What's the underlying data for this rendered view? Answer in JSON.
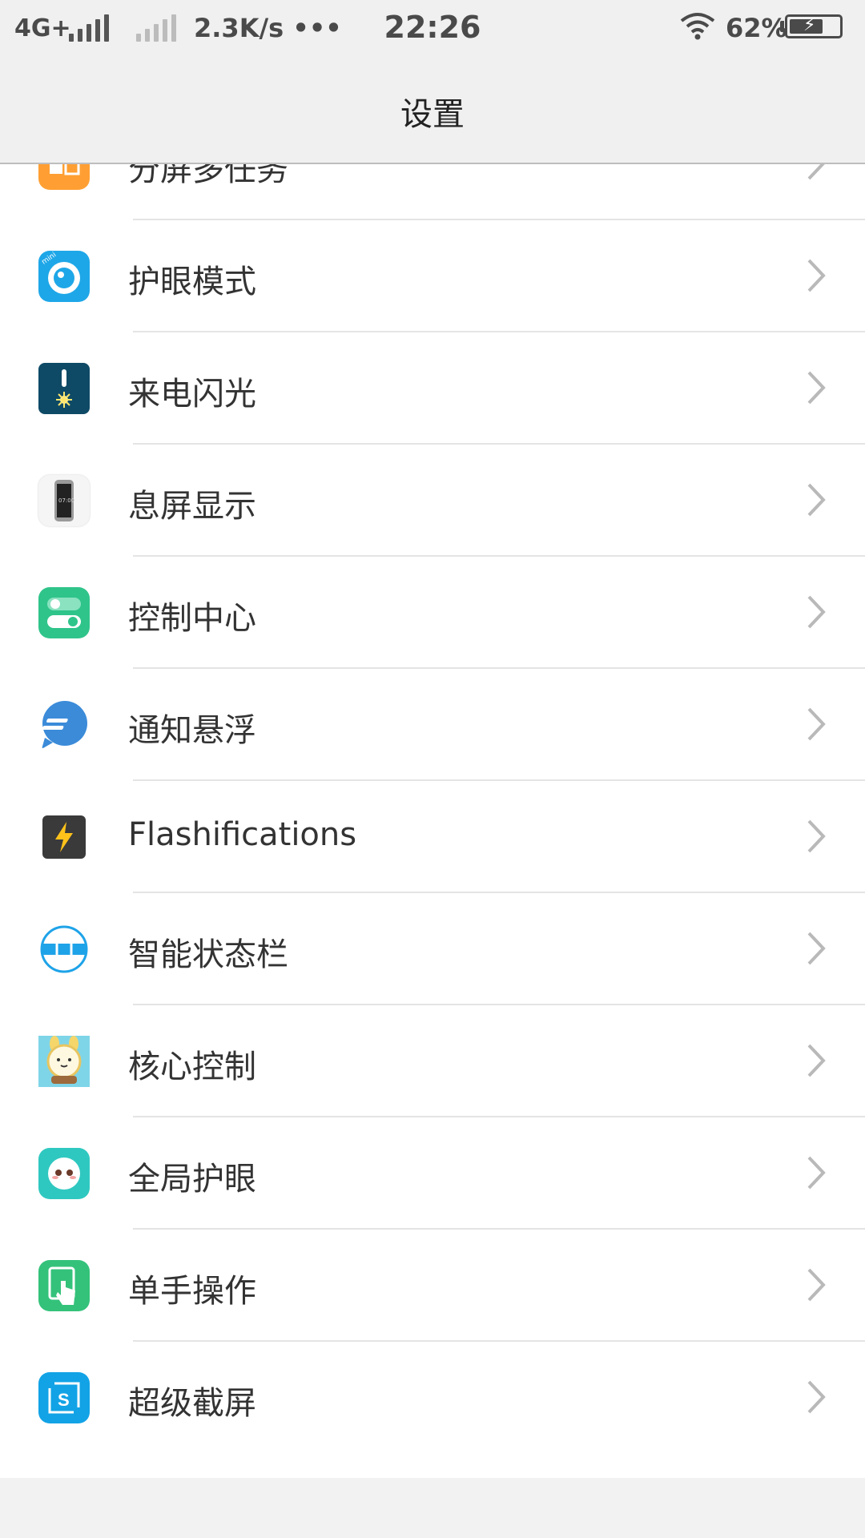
{
  "status_bar": {
    "network": "4G+",
    "speed": "2.3K/s •••",
    "time": "22:26",
    "battery": "62%"
  },
  "header": {
    "title": "设置"
  },
  "items": [
    {
      "label": "分屏多任务",
      "icon": "split-screen-icon",
      "color": "#FF9F33"
    },
    {
      "label": "护眼模式",
      "icon": "eye-care-icon",
      "color": "#1EA7E8"
    },
    {
      "label": "来电闪光",
      "icon": "call-flash-icon",
      "color": "#0E4A66"
    },
    {
      "label": "息屏显示",
      "icon": "aod-phone-icon",
      "color": "#F5F5F5"
    },
    {
      "label": "控制中心",
      "icon": "toggle-icon",
      "color": "#2FC48A"
    },
    {
      "label": "通知悬浮",
      "icon": "chat-bubble-icon",
      "color": "#3B8BD9"
    },
    {
      "label": "Flashifications",
      "icon": "lightning-icon",
      "color": "#3A3A3A"
    },
    {
      "label": "智能状态栏",
      "icon": "status-bar-icon",
      "color": "#1EA3E8"
    },
    {
      "label": "核心控制",
      "icon": "cartoon-bunny-icon",
      "color": "#7FD5E8"
    },
    {
      "label": "全局护眼",
      "icon": "cute-face-icon",
      "color": "#2FC8C0"
    },
    {
      "label": "单手操作",
      "icon": "one-hand-icon",
      "color": "#34C27A"
    },
    {
      "label": "超级截屏",
      "icon": "screenshot-icon",
      "color": "#12A3E6"
    }
  ]
}
